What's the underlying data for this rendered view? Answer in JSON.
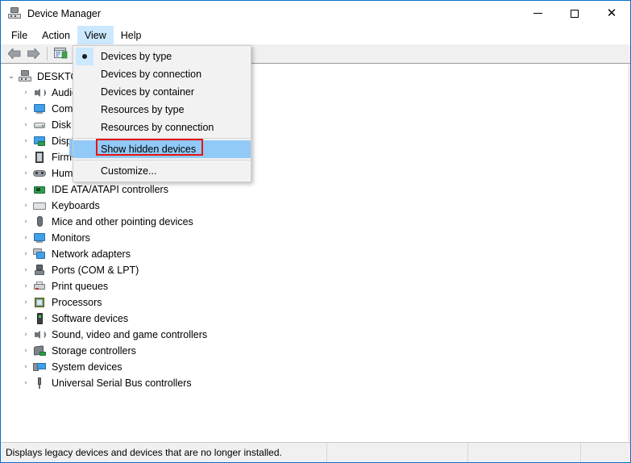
{
  "window": {
    "title": "Device Manager",
    "icon": "device-manager-icon",
    "controls": {
      "minimize": "—",
      "maximize": "☐",
      "close": "✕"
    }
  },
  "menubar": {
    "items": [
      {
        "label": "File",
        "open": false
      },
      {
        "label": "Action",
        "open": false
      },
      {
        "label": "View",
        "open": true
      },
      {
        "label": "Help",
        "open": false
      }
    ]
  },
  "toolbar": {
    "buttons": [
      {
        "name": "back-button",
        "icon": "arrow-left-icon"
      },
      {
        "name": "forward-button",
        "icon": "arrow-right-icon"
      },
      {
        "name": "properties-button",
        "icon": "properties-icon"
      }
    ]
  },
  "view_menu": {
    "items": [
      {
        "label": "Devices by type",
        "type": "radio",
        "checked": true,
        "highlighted": false,
        "separator_after": false
      },
      {
        "label": "Devices by connection",
        "type": "radio",
        "checked": false,
        "highlighted": false,
        "separator_after": false
      },
      {
        "label": "Devices by container",
        "type": "radio",
        "checked": false,
        "highlighted": false,
        "separator_after": false
      },
      {
        "label": "Resources by type",
        "type": "radio",
        "checked": false,
        "highlighted": false,
        "separator_after": false
      },
      {
        "label": "Resources by connection",
        "type": "radio",
        "checked": false,
        "highlighted": false,
        "separator_after": true
      },
      {
        "label": "Show hidden devices",
        "type": "check",
        "checked": false,
        "highlighted": true,
        "separator_after": true
      },
      {
        "label": "Customize...",
        "type": "plain",
        "checked": false,
        "highlighted": false,
        "separator_after": false
      }
    ],
    "annotation": {
      "target": "Show hidden devices",
      "color": "#e8130f"
    }
  },
  "tree": {
    "root": {
      "label": "DESKTOP-",
      "icon": "computer-icon",
      "expanded": true
    },
    "items": [
      {
        "label": "Audio inputs and outputs",
        "icon": "speaker-icon"
      },
      {
        "label": "Computer",
        "icon": "monitor-icon"
      },
      {
        "label": "Disk drives",
        "icon": "disk-drive-icon"
      },
      {
        "label": "Display adapters",
        "icon": "display-adapter-icon"
      },
      {
        "label": "Firmware",
        "icon": "firmware-icon"
      },
      {
        "label": "Human Interface Devices",
        "icon": "hid-icon"
      },
      {
        "label": "IDE ATA/ATAPI controllers",
        "icon": "ide-controller-icon"
      },
      {
        "label": "Keyboards",
        "icon": "keyboard-icon"
      },
      {
        "label": "Mice and other pointing devices",
        "icon": "mouse-icon"
      },
      {
        "label": "Monitors",
        "icon": "monitor-icon"
      },
      {
        "label": "Network adapters",
        "icon": "network-adapter-icon"
      },
      {
        "label": "Ports (COM & LPT)",
        "icon": "port-icon"
      },
      {
        "label": "Print queues",
        "icon": "printer-icon"
      },
      {
        "label": "Processors",
        "icon": "processor-icon"
      },
      {
        "label": "Software devices",
        "icon": "software-device-icon"
      },
      {
        "label": "Sound, video and game controllers",
        "icon": "speaker-icon"
      },
      {
        "label": "Storage controllers",
        "icon": "storage-controller-icon"
      },
      {
        "label": "System devices",
        "icon": "system-device-icon"
      },
      {
        "label": "Universal Serial Bus controllers",
        "icon": "usb-icon"
      }
    ],
    "expander_collapsed": "›",
    "expander_expanded": "⌄"
  },
  "statusbar": {
    "message": "Displays legacy devices and devices that are no longer installed.",
    "panel2": "",
    "panel3": "",
    "panel4": ""
  },
  "colors": {
    "window_border": "#0a70c8",
    "menu_highlight": "#91c9f7",
    "menubar_open": "#cce8ff",
    "annotation_red": "#e8130f",
    "toolbar_bg": "#f0f0f0"
  }
}
